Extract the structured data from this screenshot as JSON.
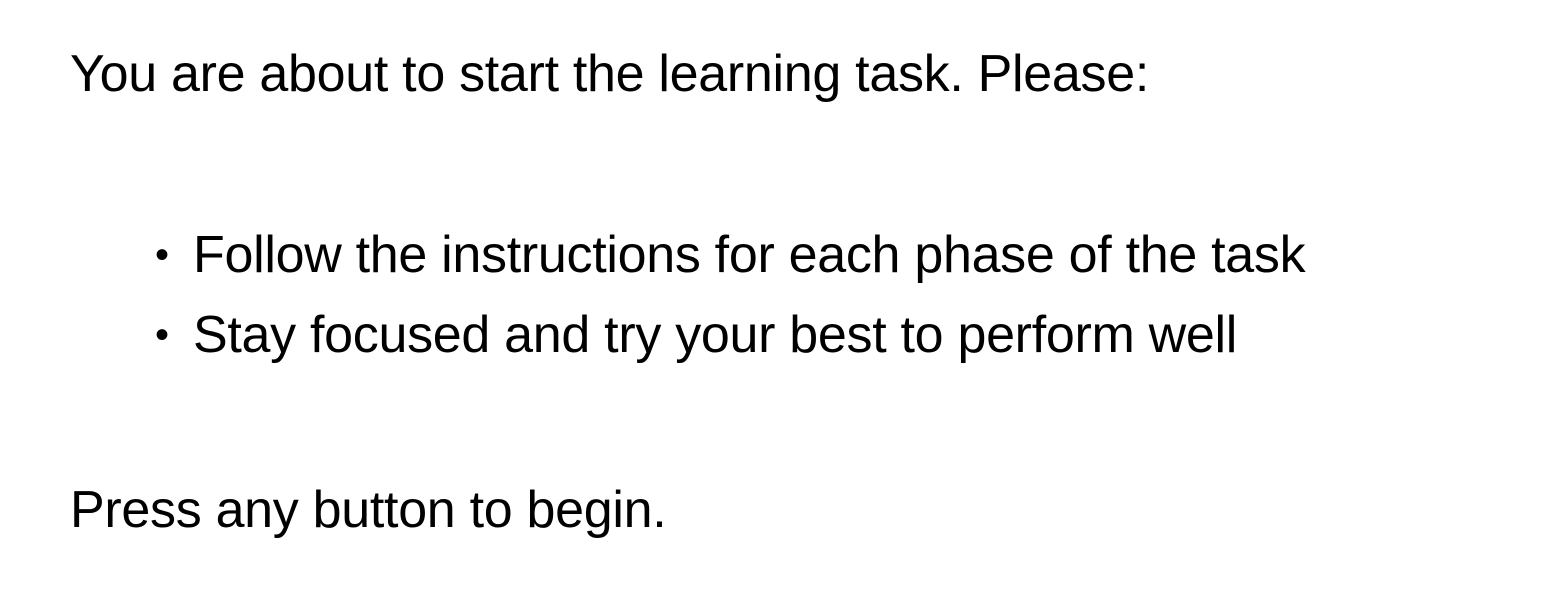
{
  "instructions": {
    "intro": "You are about to start the learning task. Please:",
    "bullet_glyph": "•",
    "bullets": [
      "Follow the instructions for each phase of the task",
      "Stay focused and try your best to perform well"
    ],
    "prompt": "Press any button to begin."
  }
}
